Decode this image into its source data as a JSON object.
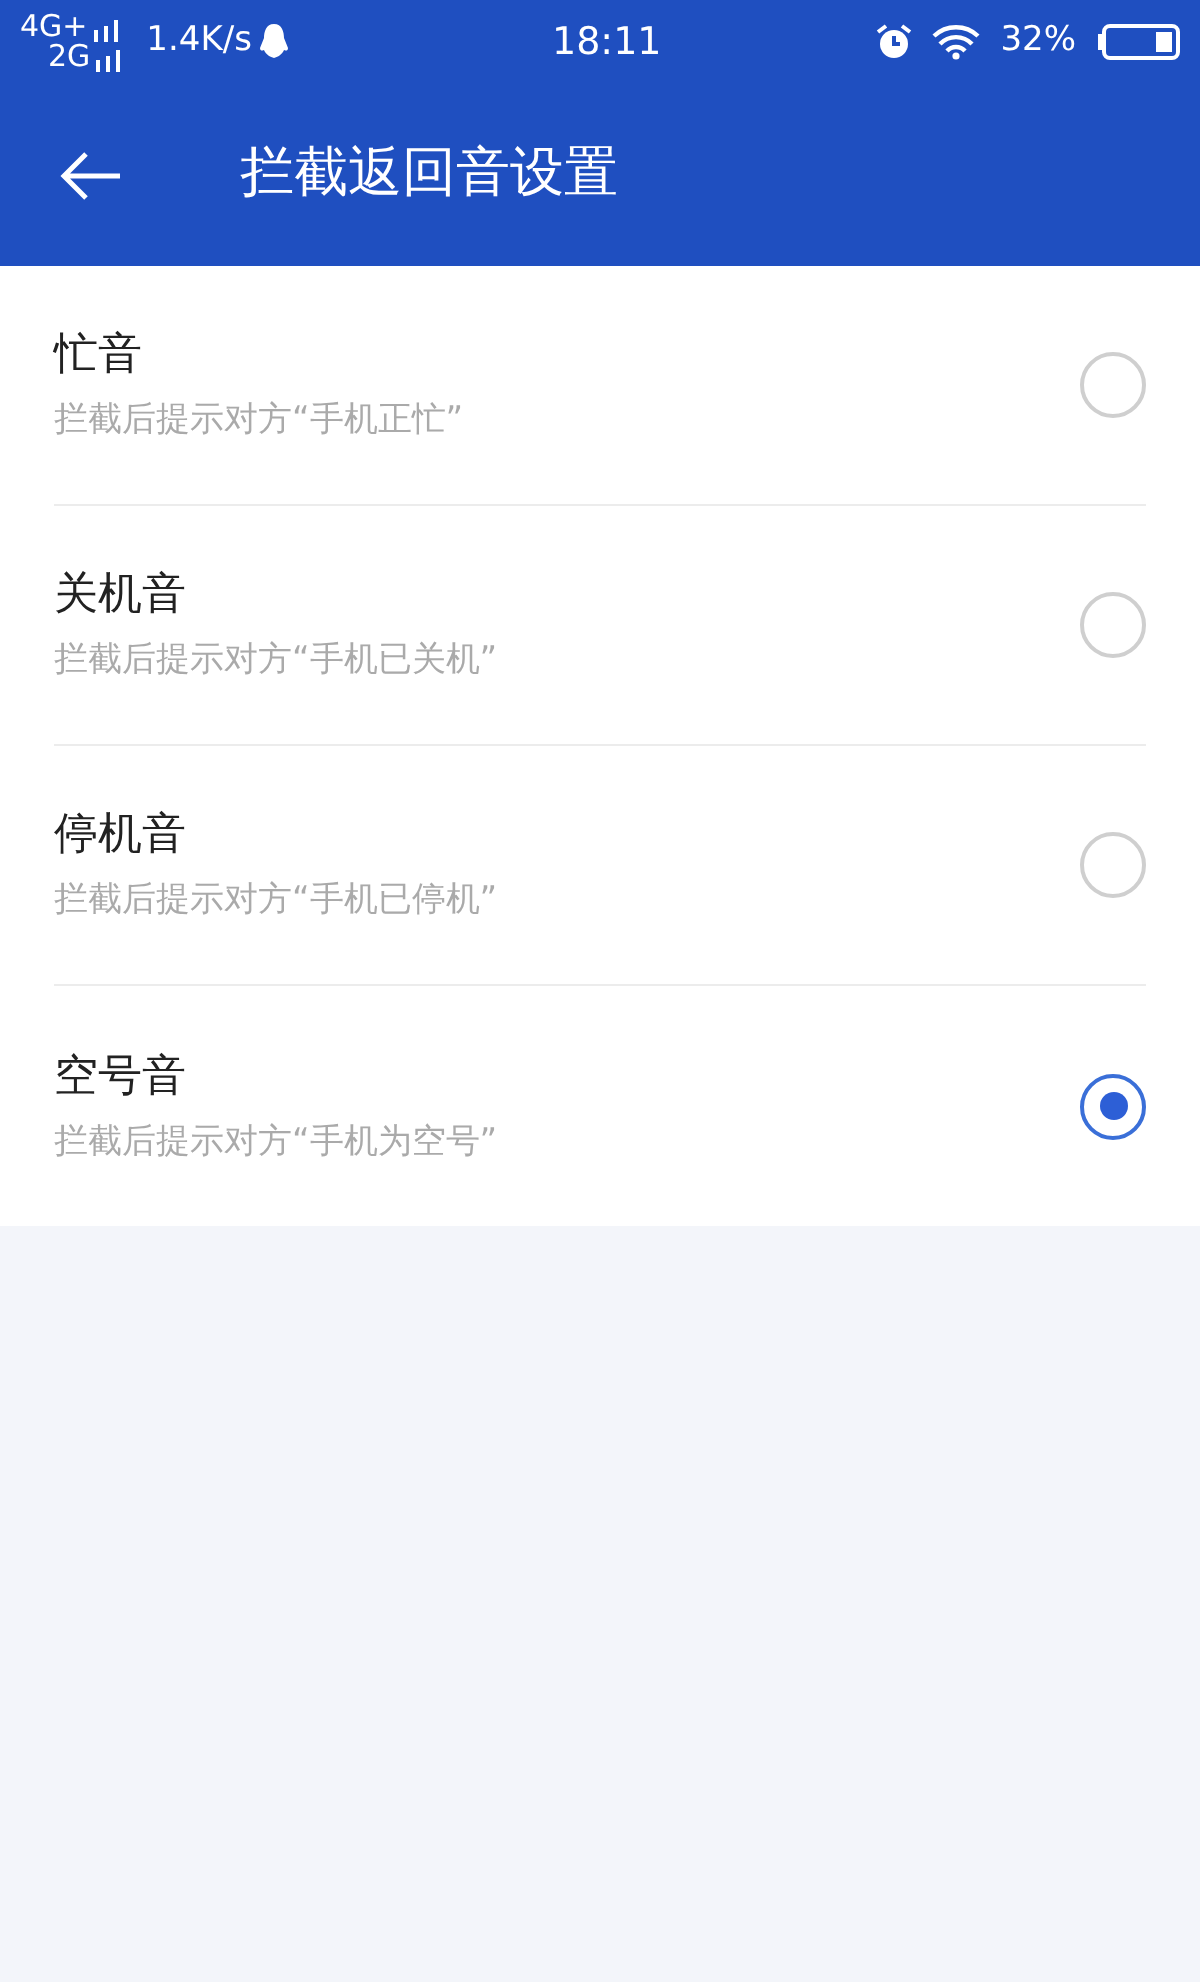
{
  "status_bar": {
    "network_1": "4G+",
    "network_2": "2G",
    "speed": "1.4K/s",
    "time": "18:11",
    "battery": "32%"
  },
  "header": {
    "title": "拦截返回音设置"
  },
  "options": [
    {
      "title": "忙音",
      "description": "拦截后提示对方“手机正忙”",
      "selected": false
    },
    {
      "title": "关机音",
      "description": "拦截后提示对方“手机已关机”",
      "selected": false
    },
    {
      "title": "停机音",
      "description": "拦截后提示对方“手机已停机”",
      "selected": false
    },
    {
      "title": "空号音",
      "description": "拦截后提示对方“手机为空号”",
      "selected": true
    }
  ]
}
